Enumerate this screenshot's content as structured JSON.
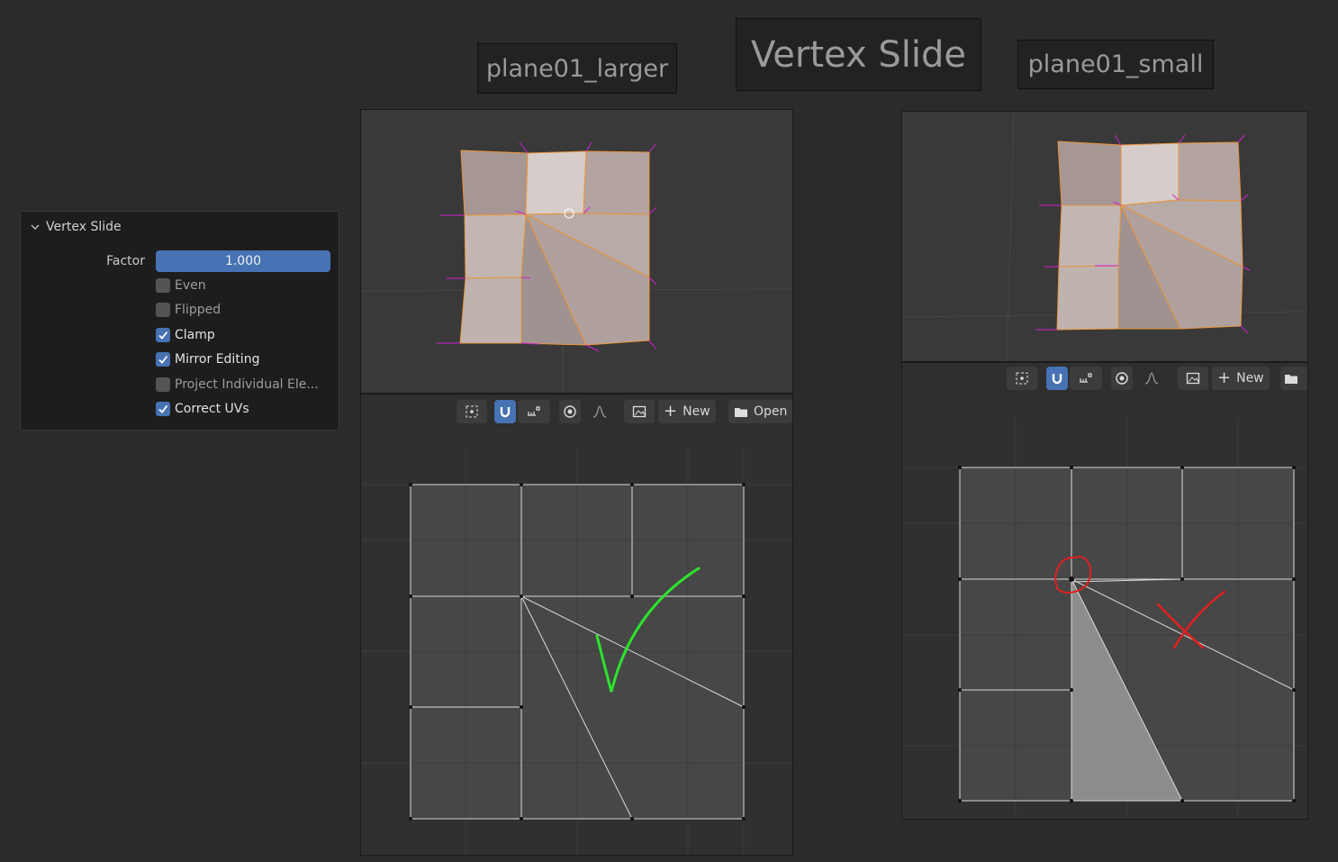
{
  "labels": {
    "left_title": "plane01_larger",
    "main_title": "Vertex Slide",
    "right_title": "plane01_small"
  },
  "operator_panel": {
    "header": "Vertex Slide",
    "factor_label": "Factor",
    "factor_value": "1.000",
    "options": [
      {
        "label": "Even",
        "checked": false
      },
      {
        "label": "Flipped",
        "checked": false
      },
      {
        "label": "Clamp",
        "checked": true
      },
      {
        "label": "Mirror Editing",
        "checked": true
      },
      {
        "label": "Project Individual Ele...",
        "checked": false
      },
      {
        "label": "Correct UVs",
        "checked": true
      }
    ]
  },
  "uv_header": {
    "new_label": "New",
    "open_label": "Open"
  },
  "annotations": {
    "left_mark": "check",
    "right_mark": "cross",
    "check_color": "#2ee22e",
    "cross_color": "#e02020"
  },
  "colors": {
    "accent": "#4772b3",
    "mesh_edge": "#e8943a",
    "face_fill": "#b7a7a3",
    "selected_face": "#d6cdca",
    "normals": "#d020d0"
  }
}
